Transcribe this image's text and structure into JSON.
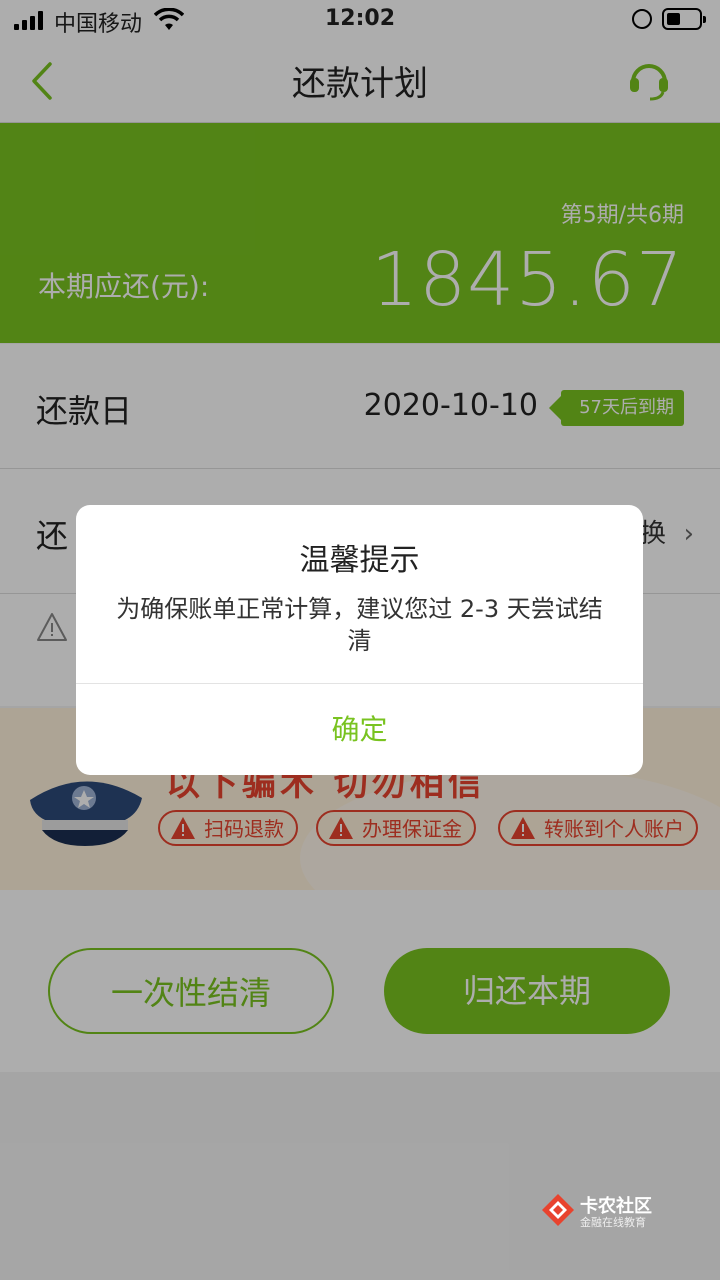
{
  "statusbar": {
    "carrier": "中国移动",
    "time": "12:02"
  },
  "navbar": {
    "title": "还款计划"
  },
  "summary": {
    "period": "第5期/共6期",
    "due_label": "本期应还(元):",
    "amount": "1845.67"
  },
  "repay_day": {
    "label": "还款日",
    "date": "2020-10-10",
    "badge": "57天后到期"
  },
  "repay_method": {
    "label_visible": "还",
    "switch_text_visible": "换"
  },
  "banner": {
    "headline_partial": "以下骗术 切勿相信",
    "pills": [
      "扫码退款",
      "办理保证金",
      "转账到个人账户"
    ]
  },
  "actions": {
    "payoff_all": "一次性结清",
    "repay_current": "归还本期"
  },
  "dialog": {
    "title": "温馨提示",
    "message": "为确保账单正常计算，建议您过 2-3 天尝试结清",
    "ok": "确定"
  },
  "watermark": {
    "title": "卡农社区",
    "subtitle": "金融在线教育"
  },
  "colors": {
    "brand_green": "#79c320",
    "alert_red": "#e8432e"
  }
}
